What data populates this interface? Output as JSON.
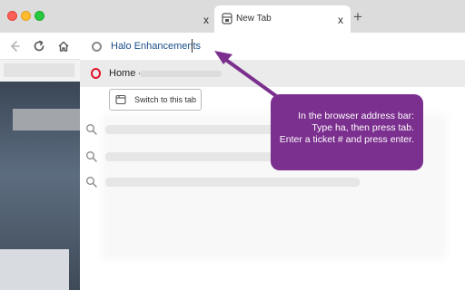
{
  "tabs": {
    "inactive_close": "x",
    "active_title": "New Tab",
    "active_close": "x",
    "new_tab": "+"
  },
  "omnibox": {
    "value": "Halo Enhancements"
  },
  "dropdown": {
    "home_label": "Home -",
    "switch_label": "Switch to this tab"
  },
  "callout": {
    "line1": "In the browser address bar:",
    "line2": "Type ha, then press tab.",
    "line3": "Enter a ticket # and press enter."
  },
  "colors": {
    "callout_bg": "#7b2f8e",
    "arrow": "#7b2f8e",
    "omnibox_text": "#1a4e8a",
    "opera_red": "#e0132b"
  },
  "icons": [
    "back-icon",
    "reload-icon",
    "home-icon",
    "opera-logo-icon",
    "switch-tab-icon",
    "search-icon"
  ]
}
